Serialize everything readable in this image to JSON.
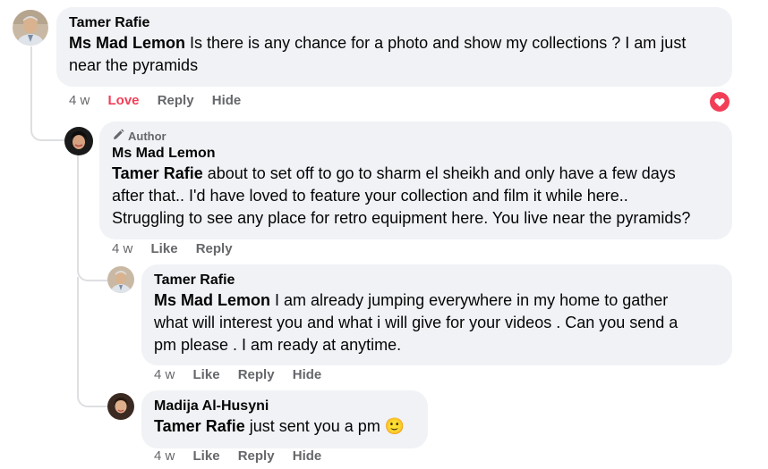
{
  "comments": [
    {
      "name": "Tamer Rafie",
      "mention": "Ms Mad Lemon",
      "text_lines": [
        "Is there is any chance for a photo and show my collections ? I am just",
        "near the pyramids"
      ],
      "time": "4 w",
      "reaction_label": "Love",
      "reply": "Reply",
      "hide": "Hide",
      "reaction_icon": "heart-icon",
      "reaction_color": "#f33e58"
    },
    {
      "badge": "Author",
      "badge_icon": "pencil-icon",
      "name": "Ms Mad Lemon",
      "mention": "Tamer Rafie",
      "text_lines": [
        "about to set off to go to sharm el sheikh and only have a few days",
        "after that.. I'd have loved to feature your collection and film it while here..",
        "Struggling to see any place for retro equipment here. You live near the pyramids?"
      ],
      "time": "4 w",
      "like": "Like",
      "reply": "Reply"
    },
    {
      "name": "Tamer Rafie",
      "mention": "Ms Mad Lemon",
      "text_lines": [
        "I am already jumping everywhere in my home to gather",
        "what will interest you and what i will give for your videos . Can you send a",
        "pm please . I am ready at anytime."
      ],
      "time": "4 w",
      "like": "Like",
      "reply": "Reply",
      "hide": "Hide"
    },
    {
      "name": "Madija Al-Husyni",
      "mention": "Tamer Rafie",
      "text": "just sent you a pm",
      "emoji": "🙂",
      "time": "4 w",
      "like": "Like",
      "reply": "Reply",
      "hide": "Hide"
    }
  ]
}
